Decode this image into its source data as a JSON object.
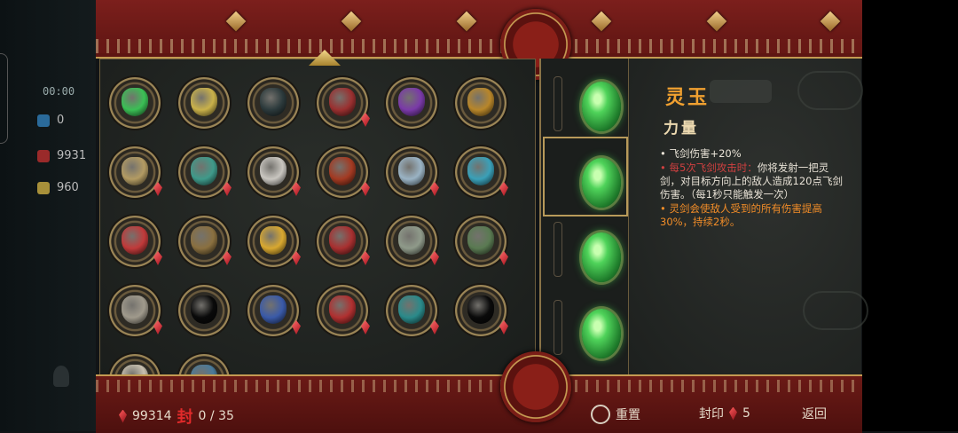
{
  "hud": {
    "time": "00:00",
    "stat1": "0",
    "stat2": "9931",
    "stat3": "960"
  },
  "detail": {
    "title": "灵玉",
    "category": "力量",
    "line1": "• 飞剑伤害+20%",
    "line2_prefix": "• ",
    "line2_red": "每5次飞剑攻击时：",
    "line2_rest": "你将发射一把灵剑，对目标方向上的敌人造成120点飞剑伤害。（每1秒只能触发一次）",
    "line3": "• 灵剑会使敌人受到的所有伤害提高30%，持续2秒。"
  },
  "bottom": {
    "currency": "99314",
    "seal_icon": "封",
    "progress": "0 / 35",
    "reset_label": "重置",
    "seal_label": "封印",
    "seal_cost": "5",
    "back_label": "返回"
  },
  "items": [
    {
      "name": "jade-gem",
      "color": "#3bbf55",
      "gem": false
    },
    {
      "name": "golden-bell",
      "color": "#c9b14a",
      "gem": false
    },
    {
      "name": "dark-bomb",
      "color": "#2c3a3c",
      "gem": false
    },
    {
      "name": "arrows",
      "color": "#9a3030",
      "gem": true
    },
    {
      "name": "purple-orb",
      "color": "#7a3aa8",
      "gem": false
    },
    {
      "name": "golden-mask",
      "color": "#b8862a",
      "gem": false
    },
    {
      "name": "drum",
      "color": "#b39b63",
      "gem": true
    },
    {
      "name": "teal-bird",
      "color": "#3f9a8a",
      "gem": true
    },
    {
      "name": "silver-pearl",
      "color": "#c9c6c0",
      "gem": true
    },
    {
      "name": "red-claw",
      "color": "#a33a22",
      "gem": true
    },
    {
      "name": "white-feather",
      "color": "#9ab3c4",
      "gem": true
    },
    {
      "name": "ice-gem",
      "color": "#3aa0b8",
      "gem": true
    },
    {
      "name": "red-blade",
      "color": "#c03a3a",
      "gem": true
    },
    {
      "name": "bronze-idol",
      "color": "#8a7040",
      "gem": true
    },
    {
      "name": "gold-heart",
      "color": "#d8a830",
      "gem": true
    },
    {
      "name": "red-crystal",
      "color": "#a83030",
      "gem": true
    },
    {
      "name": "jade-disc",
      "color": "#8f9a8a",
      "gem": true
    },
    {
      "name": "green-face",
      "color": "#5a7a52",
      "gem": true
    },
    {
      "name": "stone-fist",
      "color": "#a09a8c",
      "gem": true
    },
    {
      "name": "shadow-item",
      "color": "#0a0a0a",
      "gem": false
    },
    {
      "name": "blue-scroll",
      "color": "#3a5aa8",
      "gem": true
    },
    {
      "name": "red-lantern",
      "color": "#b03030",
      "gem": true
    },
    {
      "name": "teal-spirit",
      "color": "#2a8a8a",
      "gem": true
    },
    {
      "name": "shadow-item-2",
      "color": "#0a0a0a",
      "gem": true
    },
    {
      "name": "bone-rune",
      "color": "#c8c0b0",
      "gem": true
    },
    {
      "name": "blue-fin",
      "color": "#4a7a9a",
      "gem": true
    }
  ],
  "slots": [
    {
      "name": "slot-1"
    },
    {
      "name": "slot-2"
    },
    {
      "name": "slot-3"
    },
    {
      "name": "slot-4"
    }
  ],
  "colors": {
    "banner_red": "#7c1f1c",
    "gold_trim": "#c49a52",
    "title_orange": "#f0a030",
    "highlight_red": "#d04040",
    "highlight_orange": "#f28d28",
    "jade_green": "#3fbf4a"
  }
}
